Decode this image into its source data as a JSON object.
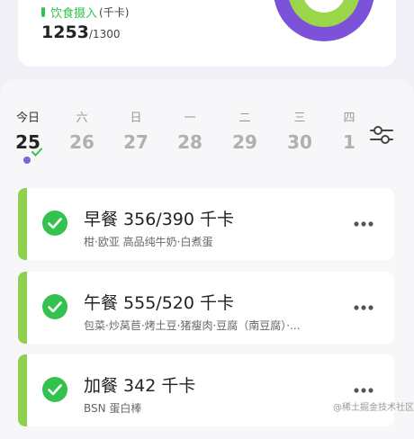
{
  "summary": {
    "intake_label": "饮食摄入",
    "intake_unit": "(千卡)",
    "intake_value": "1253",
    "intake_total": "/1300"
  },
  "calendar": {
    "days": [
      {
        "weekday": "今日",
        "date": "25",
        "active": true
      },
      {
        "weekday": "六",
        "date": "26"
      },
      {
        "weekday": "日",
        "date": "27"
      },
      {
        "weekday": "一",
        "date": "28"
      },
      {
        "weekday": "二",
        "date": "29"
      },
      {
        "weekday": "三",
        "date": "30"
      },
      {
        "weekday": "四",
        "date": "1"
      }
    ]
  },
  "meals": [
    {
      "title": "早餐 356/390 千卡",
      "foods": "柑·欧亚 高品纯牛奶·白煮蛋"
    },
    {
      "title": "午餐 555/520 千卡",
      "foods": "包菜·炒莴苣·烤土豆·猪瘦肉·豆腐（南豆腐）·..."
    },
    {
      "title": "加餐 342 千卡",
      "foods": "BSN 蛋白棒"
    }
  ],
  "watermark": "@稀土掘金技术社区",
  "colors": {
    "accent_green": "#8fd14f",
    "check_green": "#34c24f",
    "ring_green": "#9bd64a",
    "ring_purple": "#7b52d8",
    "today_dot": "#7a66d8"
  }
}
